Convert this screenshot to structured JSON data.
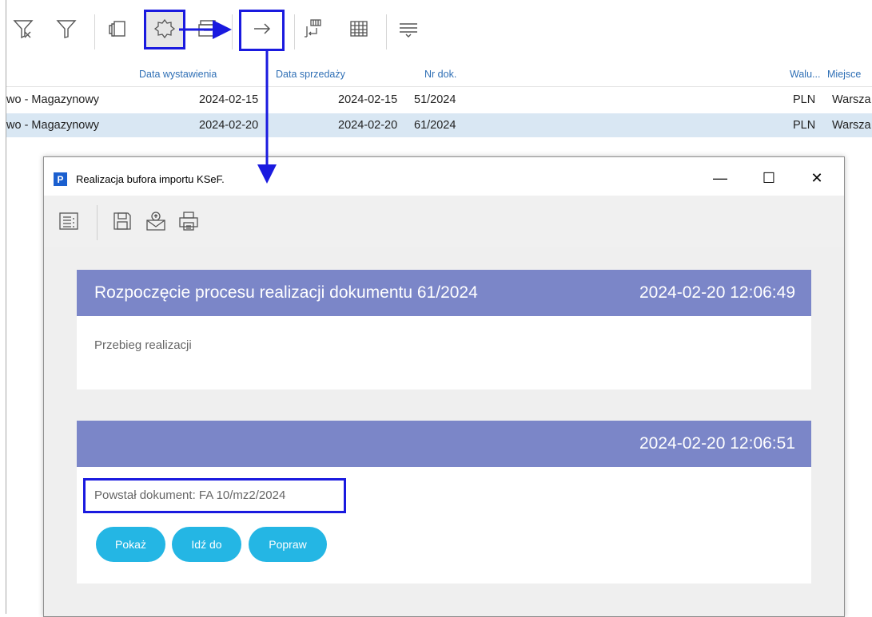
{
  "grid": {
    "headers": {
      "data_wystawienia": "Data wystawienia",
      "data_sprzedazy": "Data sprzedaży",
      "nr_dok": "Nr dok.",
      "waluta": "Walu...",
      "miejsce": "Miejsce"
    },
    "rows": [
      {
        "type": "wo - Magazynowy",
        "data_wyst": "2024-02-15",
        "data_sprz": "2024-02-15",
        "nr": "51/2024",
        "waluta": "PLN",
        "miejsce": "Warsza"
      },
      {
        "type": "wo - Magazynowy",
        "data_wyst": "2024-02-20",
        "data_sprz": "2024-02-20",
        "nr": "61/2024",
        "waluta": "PLN",
        "miejsce": "Warsza"
      }
    ]
  },
  "dialog": {
    "logo": "P",
    "title": "Realizacja bufora importu KSeF.",
    "controls": {
      "minimize": "—",
      "maximize": "☐",
      "close": "✕"
    },
    "card1": {
      "heading": "Rozpoczęcie procesu realizacji dokumentu 61/2024",
      "datetime": "2024-02-20 12:06:49",
      "body": "Przebieg realizacji"
    },
    "card2": {
      "heading": "",
      "datetime": "2024-02-20 12:06:51",
      "body": "Powstał dokument: FA 10/mz2/2024",
      "buttons": {
        "show": "Pokaż",
        "goto": "Idź do",
        "fix": "Popraw"
      }
    }
  },
  "colors": {
    "card_header": "#7b86c8",
    "button": "#24b6e4",
    "highlight": "#1a1adf",
    "selected_row": "#d9e7f3"
  },
  "icons": [
    "filter-clear-icon",
    "filter-icon",
    "copy-icon",
    "badge-icon",
    "printer-tray-icon",
    "arrow-right-icon",
    "export-icon",
    "grid-icon",
    "collapse-icon",
    "list-icon",
    "save-icon",
    "mail-icon",
    "print-icon"
  ]
}
